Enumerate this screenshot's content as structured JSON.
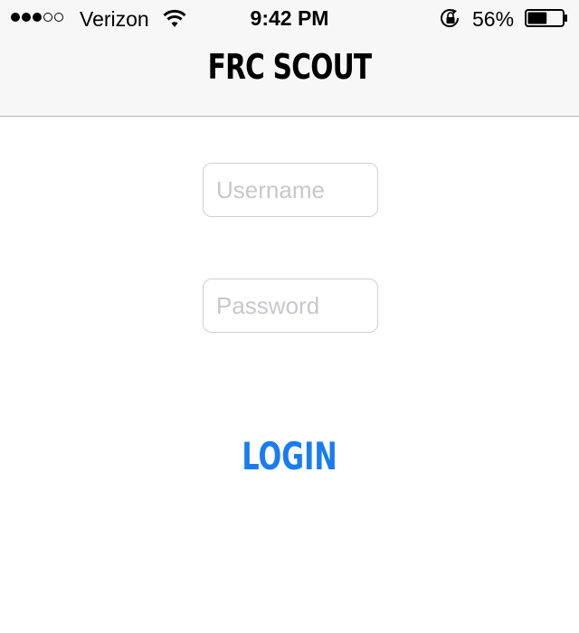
{
  "status_bar": {
    "carrier": "Verizon",
    "signal_bars_filled": 3,
    "signal_bars_total": 5,
    "time": "9:42 PM",
    "battery_percent": "56%",
    "battery_level": 0.56,
    "icons": [
      "wifi-icon",
      "rotation-lock-icon",
      "battery-icon"
    ]
  },
  "nav": {
    "title": "FRC SCOUT"
  },
  "form": {
    "username_placeholder": "Username",
    "username_value": "",
    "password_placeholder": "Password",
    "password_value": "",
    "login_label": "LOGIN"
  },
  "colors": {
    "accent": "#1a7cf0",
    "nav_background": "#f7f7f7",
    "placeholder": "#c7c7cd"
  }
}
